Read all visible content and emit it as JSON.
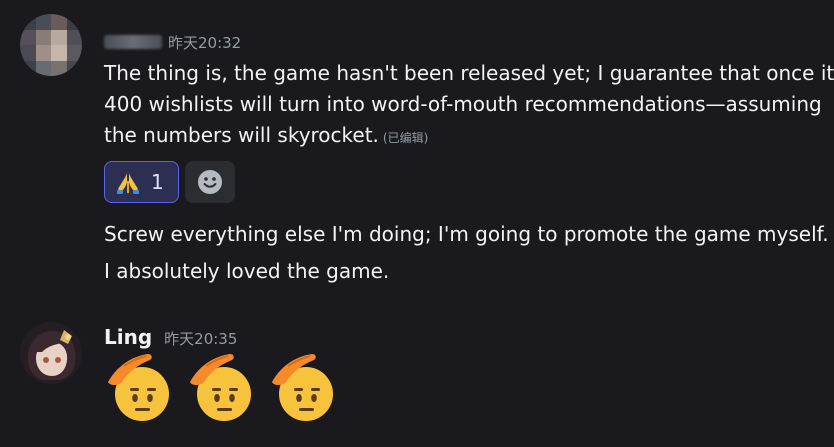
{
  "message1": {
    "timestamp": "昨天20:32",
    "lines": [
      "The thing is, the game hasn't been released yet; I guarantee that once it l",
      "400 wishlists will turn into word-of-mouth recommendations—assuming",
      "the numbers will skyrocket."
    ],
    "edited_label": "(已编辑)",
    "reactions": [
      {
        "emoji": "🙏",
        "count": "1"
      }
    ],
    "add_reaction_icon": "add-reaction-icon"
  },
  "message2": {
    "text": "Screw everything else I'm doing; I'm going to promote the game myself."
  },
  "message3": {
    "text": "I absolutely loved the game."
  },
  "message4": {
    "username": "Ling",
    "timestamp": "昨天20:35",
    "emojis": [
      "saluting-face",
      "saluting-face",
      "saluting-face"
    ]
  },
  "colors": {
    "background": "#1a1a1e",
    "text": "#f2f3f5",
    "muted": "#949ba4",
    "reaction_bg": "#2c2e52",
    "reaction_border": "#5865f2",
    "emoji_yellow": "#f7c23c",
    "emoji_hand": "#f48a29"
  }
}
